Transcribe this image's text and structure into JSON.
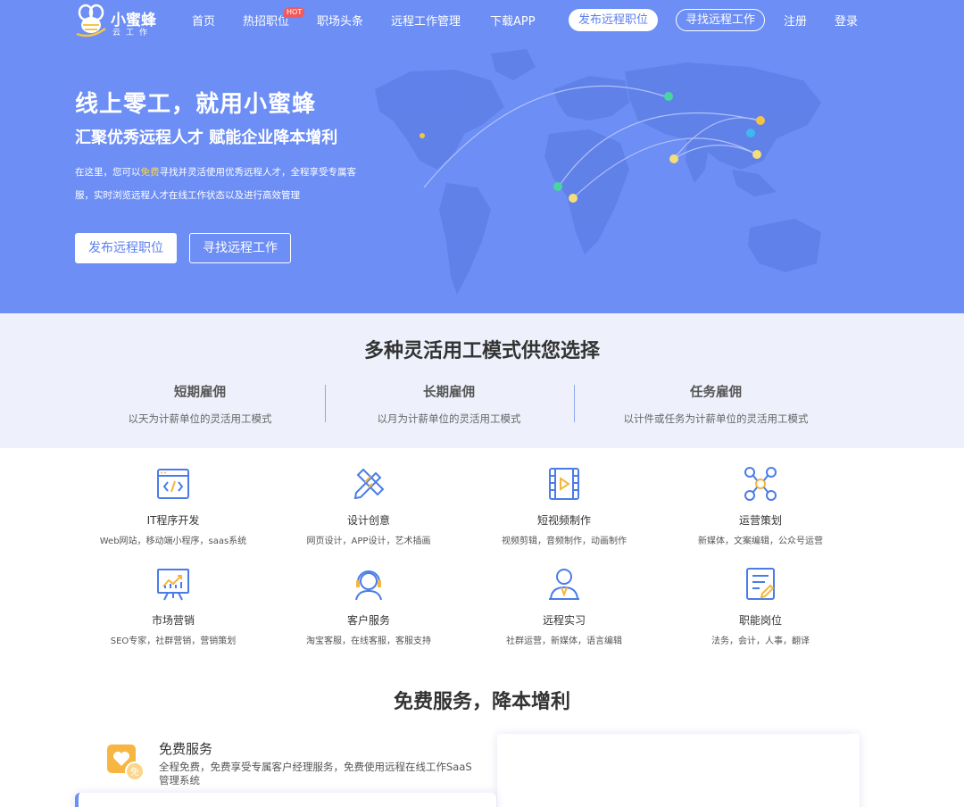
{
  "header": {
    "logo": {
      "title": "小蜜蜂",
      "subtitle": "云工作"
    },
    "nav": [
      {
        "label": "首页"
      },
      {
        "label": "热招职位",
        "badge": "HOT"
      },
      {
        "label": "职场头条"
      },
      {
        "label": "远程工作管理"
      },
      {
        "label": "下载APP"
      }
    ],
    "post_button": "发布远程职位",
    "find_button": "寻找远程工作",
    "register": "注册",
    "login": "登录"
  },
  "hero": {
    "title": "线上零工，就用小蜜蜂",
    "subtitle": "汇聚优秀远程人才 赋能企业降本增利",
    "desc_prefix": "在这里，您可以",
    "desc_highlight": "免费",
    "desc_suffix": "寻找并灵活使用优秀远程人才，全程享受专属客服，实时浏览远程人才在线工作状态以及进行高效管理",
    "post_button": "发布远程职位",
    "find_button": "寻找远程工作"
  },
  "modes": {
    "title": "多种灵活用工模式供您选择",
    "items": [
      {
        "title": "短期雇佣",
        "desc": "以天为计薪单位的灵活用工模式"
      },
      {
        "title": "长期雇佣",
        "desc": "以月为计薪单位的灵活用工模式"
      },
      {
        "title": "任务雇佣",
        "desc": "以计件或任务为计薪单位的灵活用工模式"
      }
    ]
  },
  "services": [
    {
      "title": "IT程序开发",
      "desc": "Web网站，移动端小程序，saas系统",
      "icon": "code-window-icon"
    },
    {
      "title": "设计创意",
      "desc": "网页设计，APP设计，艺术插画",
      "icon": "pencil-ruler-icon"
    },
    {
      "title": "短视频制作",
      "desc": "视频剪辑，音频制作，动画制作",
      "icon": "film-icon"
    },
    {
      "title": "运营策划",
      "desc": "新媒体，文案编辑，公众号运营",
      "icon": "network-icon"
    },
    {
      "title": "市场营销",
      "desc": "SEO专家，社群营销，营销策划",
      "icon": "chart-board-icon"
    },
    {
      "title": "客户服务",
      "desc": "淘宝客服，在线客服，客服支持",
      "icon": "headset-icon"
    },
    {
      "title": "远程实习",
      "desc": "社群运营，新媒体，语言编辑",
      "icon": "intern-icon"
    },
    {
      "title": "职能岗位",
      "desc": "法务，会计，人事，翻译",
      "icon": "document-pen-icon"
    }
  ],
  "free": {
    "title": "免费服务，降本增利",
    "item_title": "免费服务",
    "item_desc": "全程免费，免费享受专属客户经理服务，免费使用远程在线工作SaaS管理系统",
    "badge_char": "免"
  },
  "colors": {
    "brand": "#6c8ef5",
    "button_text": "#5b7fef",
    "highlight": "#ffd54a",
    "hot_badge": "#f25a5a",
    "section_bg": "#eef1fb",
    "free_icon": "#f7b642"
  }
}
